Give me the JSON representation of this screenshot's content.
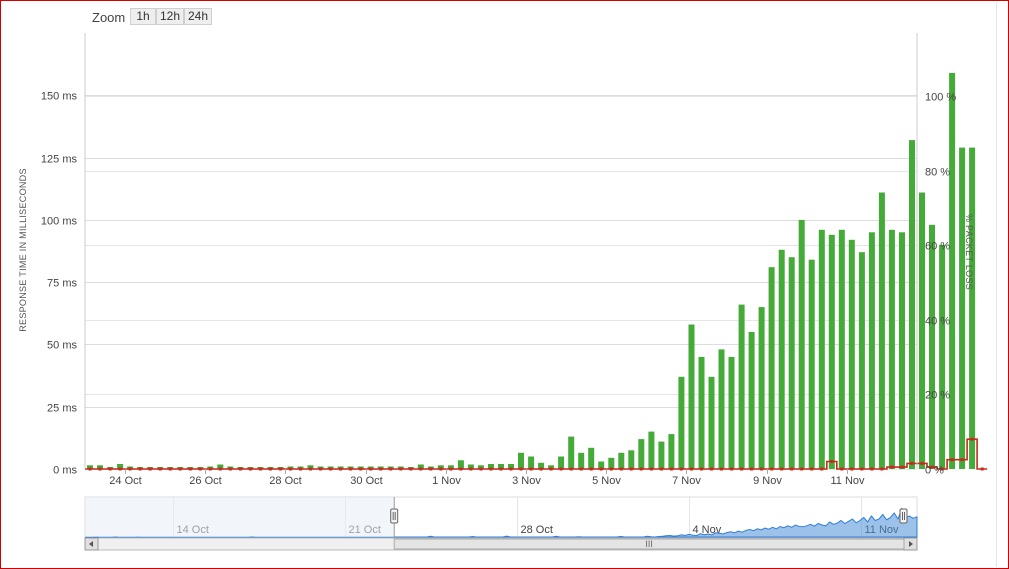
{
  "zoom": {
    "label": "Zoom",
    "buttons": [
      "1h",
      "12h",
      "24h"
    ]
  },
  "chart_data": {
    "type": "bar",
    "title": "",
    "left_axis": {
      "title": "RESPONSE TIME IN MILLISECONDS",
      "min": 0,
      "max": 175,
      "ticks": [
        0,
        25,
        50,
        75,
        100,
        125,
        150
      ],
      "tick_labels": [
        "0 ms",
        "25 ms",
        "50 ms",
        "75 ms",
        "100 ms",
        "125 ms",
        "150 ms"
      ]
    },
    "right_axis": {
      "title": "% PACKET LOSS",
      "min": 0,
      "max": 117,
      "ticks": [
        0,
        20,
        40,
        60,
        80,
        100
      ],
      "tick_labels": [
        "0 %",
        "20 %",
        "40 %",
        "60 %",
        "80 %",
        "100 %"
      ]
    },
    "x_axis": {
      "start_day": 23,
      "end_day": 43.75,
      "tick_days": [
        24,
        26,
        28,
        30,
        32,
        34,
        36,
        38,
        40,
        42
      ],
      "tick_labels": [
        "24 Oct",
        "26 Oct",
        "28 Oct",
        "30 Oct",
        "1 Nov",
        "3 Nov",
        "5 Nov",
        "7 Nov",
        "9 Nov",
        "11 Nov"
      ]
    },
    "grid": true,
    "legend": "none",
    "series": [
      {
        "axis": "left",
        "color": "#44aa38",
        "step_days": 0.25,
        "start_day": 23,
        "values": [
          1.5,
          1.5,
          0.8,
          2,
          1,
          0.8,
          0.8,
          0.8,
          0.8,
          0.8,
          0.8,
          0.8,
          1,
          1.8,
          1,
          0.8,
          0.8,
          0.8,
          0.8,
          0.8,
          1,
          1,
          1.5,
          1,
          1,
          1,
          1,
          1,
          1,
          1,
          1,
          1,
          0.8,
          1.8,
          1,
          1.5,
          1.5,
          3.5,
          1.8,
          1.5,
          2,
          2,
          2,
          6.5,
          5,
          2.5,
          1.5,
          5,
          13,
          6.5,
          8.5,
          3,
          4.5,
          6.5,
          7.5,
          12,
          15,
          11,
          14,
          37,
          58,
          45,
          37,
          48,
          45,
          66,
          55,
          65,
          81,
          88,
          85,
          100,
          84,
          96,
          94,
          96,
          92,
          87,
          95,
          111,
          96,
          95,
          132,
          111,
          98,
          90,
          159,
          129,
          129
        ]
      },
      {
        "axis": "right",
        "color": "#c8281e",
        "type": "step",
        "step_days": 0.25,
        "start_day": 23,
        "values": [
          0,
          0,
          0,
          0,
          0,
          0,
          0,
          0,
          0,
          0,
          0,
          0,
          0,
          0,
          0,
          0,
          0,
          0,
          0,
          0,
          0,
          0,
          0,
          0,
          0,
          0,
          0,
          0,
          0,
          0,
          0,
          0,
          0,
          0,
          0,
          0,
          0,
          0,
          0,
          0,
          0,
          0,
          0,
          0,
          0,
          0,
          0,
          0,
          0,
          0,
          0,
          0,
          0,
          0,
          0,
          0,
          0,
          0,
          0,
          0,
          0,
          0,
          0,
          0,
          0,
          0,
          0,
          0,
          0,
          0,
          0,
          0,
          0,
          0,
          2,
          0,
          0,
          0,
          0,
          0,
          0.5,
          0.5,
          1.5,
          1.5,
          0.5,
          0,
          2.5,
          2.5,
          8,
          0
        ]
      }
    ]
  },
  "navigator": {
    "tick_labels": [
      "14 Oct",
      "21 Oct",
      "28 Oct",
      "4 Nov",
      "11 Nov"
    ],
    "tick_days": [
      14,
      21,
      28,
      35,
      42
    ],
    "start_day": 10.4,
    "end_day": 44.3,
    "selected_start_day": 23,
    "selected_end_day": 43.75,
    "area_color": "#4a90d9",
    "scrollbar_grip": "III",
    "values": [
      0,
      0,
      0,
      0.2,
      0,
      0,
      0,
      0,
      0.3,
      0,
      0,
      0,
      0,
      0,
      0.2,
      0,
      0,
      0,
      0,
      0,
      0,
      0,
      0,
      0,
      0,
      0,
      0,
      0,
      0,
      0,
      0,
      0,
      0,
      0,
      0,
      0,
      0,
      0,
      0,
      0,
      0,
      0,
      0,
      0,
      0.4,
      0,
      0,
      0,
      0,
      0,
      0,
      0,
      0,
      0,
      0,
      0,
      0,
      0,
      0,
      0,
      0,
      0,
      0,
      0,
      0,
      0,
      0,
      0,
      0,
      0,
      0,
      0,
      0,
      0,
      0,
      0,
      0,
      0,
      0,
      0,
      0,
      0,
      0,
      0,
      0,
      0,
      0,
      0,
      0,
      0,
      0,
      0.5,
      0,
      0,
      0,
      0,
      0,
      0,
      0,
      0,
      0,
      0,
      0.3,
      0,
      0,
      0,
      0,
      0,
      0,
      0,
      0,
      0.6,
      0,
      0,
      0,
      0,
      0,
      0,
      0,
      0,
      0,
      0,
      0,
      0,
      0.5,
      0,
      0,
      0,
      0,
      0,
      0.2,
      0,
      0,
      0,
      0,
      0,
      0,
      0,
      0,
      0,
      0,
      0.4,
      0,
      0,
      0,
      0,
      0,
      0,
      0.5,
      0.2,
      0,
      0.3,
      0.5,
      0.8,
      1,
      0.6,
      0.8,
      1.5,
      1,
      1.8,
      1.2,
      1,
      2.2,
      1.5,
      2,
      1.5,
      2.8,
      2.5,
      2,
      3,
      3.5,
      2.8,
      4,
      3.2,
      4.5,
      5,
      4.2,
      5.5,
      4.8,
      6,
      5.2,
      6.5,
      5.5,
      7,
      6.2,
      7.5,
      6.5,
      8,
      7,
      6.8,
      7.5,
      8.5,
      7.2,
      9,
      8,
      7.5,
      10,
      8.5,
      9.2,
      11,
      9,
      10.5,
      12,
      9.5,
      11,
      13,
      10,
      14,
      11,
      12,
      15,
      11.5,
      13,
      16,
      12,
      19,
      13,
      14,
      12.5,
      13.5
    ]
  }
}
